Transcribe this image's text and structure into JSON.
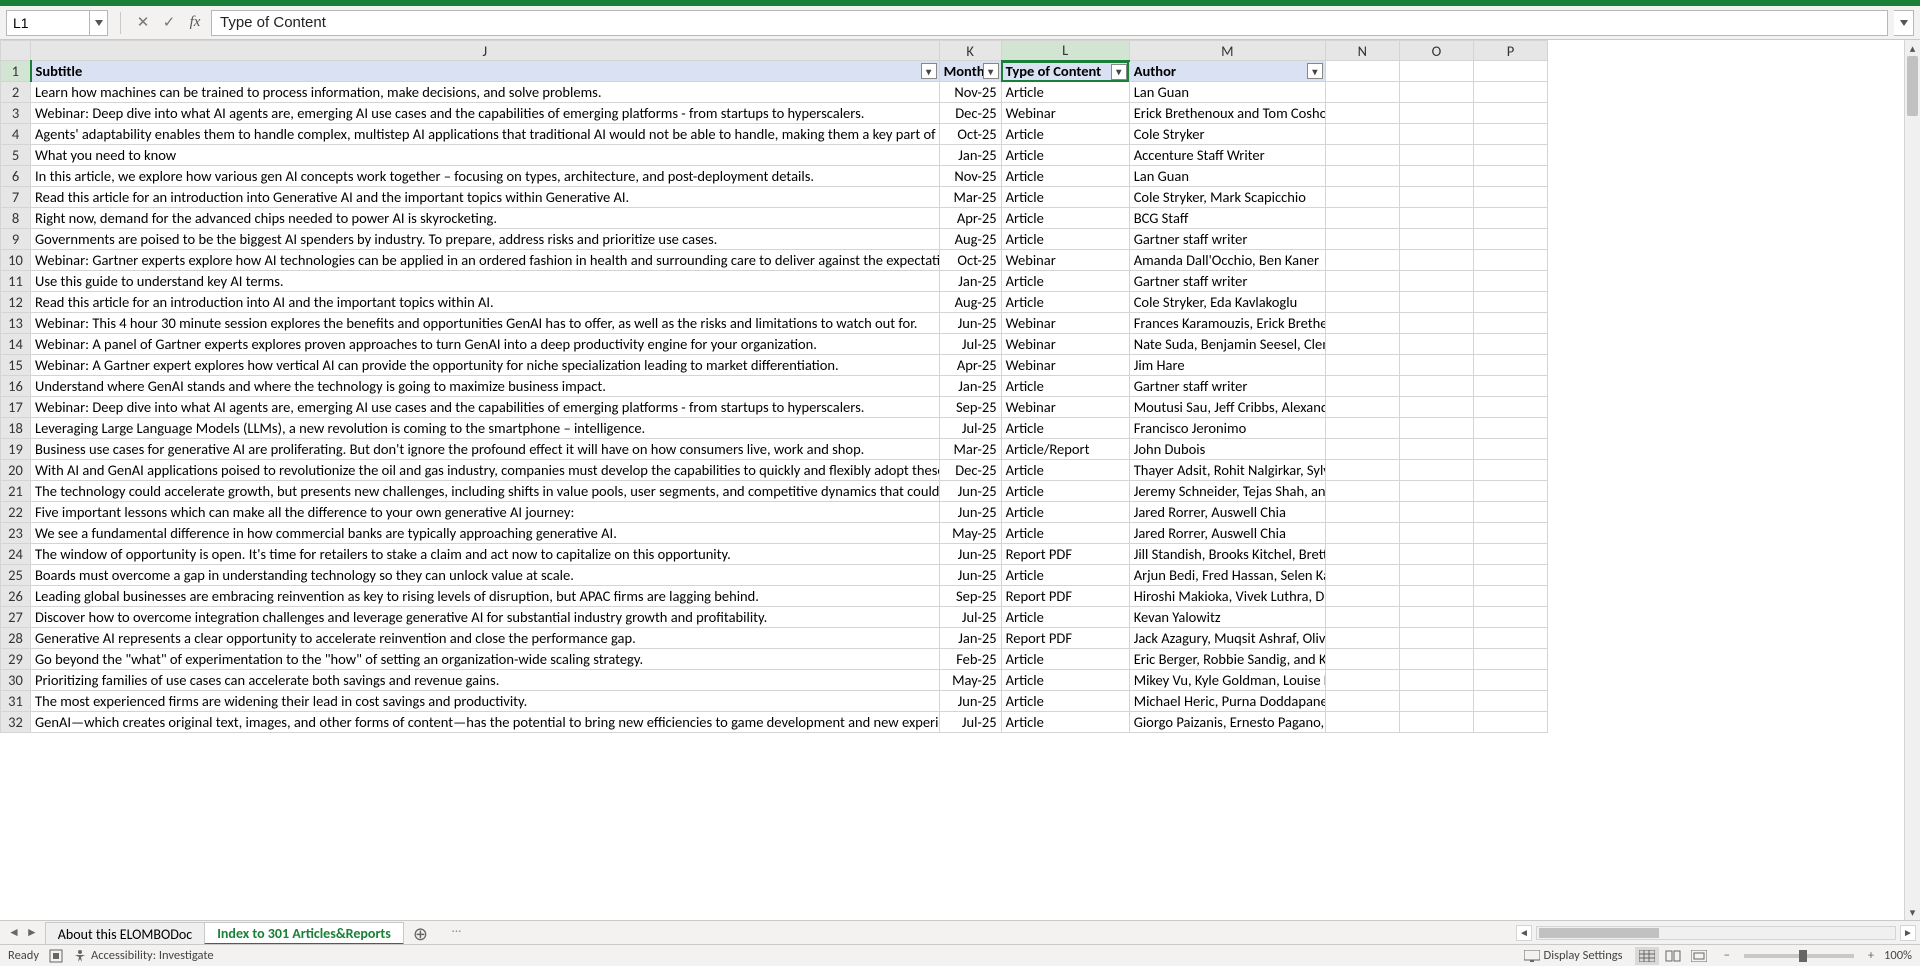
{
  "formula_bar": {
    "cell_ref": "L1",
    "formula_value": "Type of Content"
  },
  "columns": {
    "visible": [
      "J",
      "K",
      "L",
      "M",
      "N",
      "O",
      "P"
    ],
    "selected": "L"
  },
  "header_row": {
    "J": "Subtitle",
    "K": "Month P",
    "L": "Type of Content",
    "M": "Author",
    "N": "",
    "O": "",
    "P": ""
  },
  "rows": [
    {
      "n": 2,
      "J": "Learn how machines can be trained to process information, make decisions, and solve problems.",
      "K": "Nov-25",
      "L": "Article",
      "M": "Lan Guan"
    },
    {
      "n": 3,
      "J": "Webinar: Deep dive into what AI agents are, emerging AI use cases and the capabilities of emerging platforms - from startups to hyperscalers.",
      "K": "Dec-25",
      "L": "Webinar",
      "M": "Erick Brethenoux and Tom Coshow"
    },
    {
      "n": 4,
      "J": "Agents' adaptability enables them to handle complex, multistep AI applications that traditional AI would not be able to handle, making them a key part of the mo",
      "K": "Oct-25",
      "L": "Article",
      "M": "Cole Stryker"
    },
    {
      "n": 5,
      "J": "What you need to know",
      "K": "Jan-25",
      "L": "Article",
      "M": "Accenture Staff Writer"
    },
    {
      "n": 6,
      "J": "In this article, we explore how various gen AI concepts work together – focusing on types, architecture, and post-deployment details.",
      "K": "Nov-25",
      "L": "Article",
      "M": "Lan Guan"
    },
    {
      "n": 7,
      "J": "Read this article for an introduction into Generative AI and the important topics within Generative AI.",
      "K": "Mar-25",
      "L": "Article",
      "M": "Cole Stryker, Mark Scapicchio"
    },
    {
      "n": 8,
      "J": "Right now, demand for the advanced chips needed to power AI is skyrocketing.",
      "K": "Apr-25",
      "L": "Article",
      "M": "BCG Staff"
    },
    {
      "n": 9,
      "J": "Governments are poised to be the biggest AI spenders by industry. To prepare, address risks and prioritize use cases.",
      "K": "Aug-25",
      "L": "Article",
      "M": "Gartner staff writer"
    },
    {
      "n": 10,
      "J": "Webinar: Gartner experts explore how AI technologies can be applied in an ordered fashion in health and surrounding care to deliver against the expectations o",
      "K": "Oct-25",
      "L": "Webinar",
      "M": "Amanda Dall'Occhio, Ben Kaner"
    },
    {
      "n": 11,
      "J": "Use this guide to understand key AI terms.",
      "K": "Jan-25",
      "L": "Article",
      "M": "Gartner staff writer"
    },
    {
      "n": 12,
      "J": "Read this article for an introduction into AI and the important topics within AI.",
      "K": "Aug-25",
      "L": "Article",
      "M": "Cole Stryker, Eda Kavlakoglu"
    },
    {
      "n": 13,
      "J": "Webinar: This 4 hour 30 minute session explores the benefits and opportunities GenAI has to offer, as well as the risks and limitations to watch out for.",
      "K": "Jun-25",
      "L": "Webinar",
      "M": "Frances Karamouzis, Erick Brethenoux, Helen Poitevin, Uma Challa, Ar"
    },
    {
      "n": 14,
      "J": "Webinar: A panel of Gartner experts explores proven approaches to turn GenAI into a deep productivity engine for your organization.",
      "K": "Jul-25",
      "L": "Webinar",
      "M": "Nate Suda, Benjamin Seesel, Clement Christensen"
    },
    {
      "n": 15,
      "J": "Webinar: A Gartner expert explores how vertical AI can provide the opportunity for niche specialization leading to market differentiation.",
      "K": "Apr-25",
      "L": "Webinar",
      "M": "Jim Hare"
    },
    {
      "n": 16,
      "J": "Understand where GenAI stands and where the technology is going to maximize business impact.",
      "K": "Jan-25",
      "L": "Article",
      "M": "Gartner staff writer"
    },
    {
      "n": 17,
      "J": "Webinar: Deep dive into what AI agents are, emerging AI use cases and the capabilities of emerging platforms - from startups to hyperscalers.",
      "K": "Sep-25",
      "L": "Webinar",
      "M": "Moutusi Sau, Jeff Cribbs, Alexander Hoeppe"
    },
    {
      "n": 18,
      "J": "Leveraging Large Language Models (LLMs), a new revolution is coming to the smartphone – intelligence.",
      "K": "Jul-25",
      "L": "Article",
      "M": "Francisco Jeronimo"
    },
    {
      "n": 19,
      "J": "Business use cases for generative AI are proliferating. But don't ignore the profound effect it will have on how consumers live, work and shop.",
      "K": "Mar-25",
      "L": "Article/Report",
      "M": "John Dubois"
    },
    {
      "n": 20,
      "J": "With AI and GenAI applications poised to revolutionize the oil and gas industry, companies must develop the capabilities to quickly and flexibly adopt these new",
      "K": "Dec-25",
      "L": "Article",
      "M": "Thayer Adsit,  Rohit Nalgirkar,  Sylvain Santamarta, Ramya Sethurathina"
    },
    {
      "n": 21,
      "J": "The technology could accelerate growth, but presents new challenges, including shifts in value pools, user segments, and competitive dynamics that could spu",
      "K": "Jun-25",
      "L": "Article",
      "M": "Jeremy Schneider, Tejas Shah, and Joshan Cherian Abraham"
    },
    {
      "n": 22,
      "J": "Five important lessons which can make all the difference to your own generative AI journey:",
      "K": "Jun-25",
      "L": "Article",
      "M": "Jared Rorrer, Auswell Chia"
    },
    {
      "n": 23,
      "J": "We see a fundamental difference in how commercial banks are typically approaching generative AI.",
      "K": "May-25",
      "L": "Article",
      "M": "Jared Rorrer, Auswell Chia"
    },
    {
      "n": 24,
      "J": "The window of opportunity is open. It's time for retailers to stake a claim and act now to capitalize on this opportunity.",
      "K": "Jun-25",
      "L": "Report PDF",
      "M": "Jill Standish, Brooks Kitchel, Brett Leary, Sarah Berger"
    },
    {
      "n": 25,
      "J": "Boards must overcome a gap in understanding technology so they can unlock value at scale.",
      "K": "Jun-25",
      "L": "Article",
      "M": "Arjun Bedi, Fred Hassan, Selen Karaca-Griffin"
    },
    {
      "n": 26,
      "J": "Leading global businesses are embracing reinvention as key to rising levels of disruption, but APAC firms are lagging behind.",
      "K": "Sep-25",
      "L": "Report PDF",
      "M": "Hiroshi Makioka, Vivek Luthra, Dr. Serena Jiong Qiu"
    },
    {
      "n": 27,
      "J": "Discover how to overcome integration challenges and leverage generative AI for substantial industry growth and profitability.",
      "K": "Jul-25",
      "L": "Article",
      "M": "Kevan Yalowitz"
    },
    {
      "n": 28,
      "J": "Generative AI represents a clear opportunity to accelerate reinvention and close the performance gap.",
      "K": "Jan-25",
      "L": "Report PDF",
      "M": "Jack Azagury, Muqsit Ashraf, Oliver Wright, Karen Fang Grant, Mike Moo"
    },
    {
      "n": 29,
      "J": "Go beyond the \"what\" of experimentation to the \"how\" of setting an organization-wide scaling strategy.",
      "K": "Feb-25",
      "L": "Article",
      "M": "Eric Berger, Robbie Sandig, and KC George"
    },
    {
      "n": 30,
      "J": "Prioritizing families of use cases can accelerate both savings and revenue gains.",
      "K": "May-25",
      "L": "Article",
      "M": "Mikey Vu, Kyle Goldman, Louise Keely, Carla Nasr, and François Vayleu"
    },
    {
      "n": 31,
      "J": "The most experienced firms are widening their lead in cost savings and productivity.",
      "K": "Jun-25",
      "L": "Article",
      "M": "Michael Heric, Purna Doddapaneni, and Don Sweeney"
    },
    {
      "n": 32,
      "J": "GenAI—which creates original text, images, and other forms of content—has the potential to bring new efficiencies to game development and new experiences",
      "K": "Jul-25",
      "L": "Article",
      "M": "Giorgo Paizanis,  Ernesto Pagano, David Sammons,  and Nicolas Schmi"
    }
  ],
  "tabs": {
    "items": [
      "About this ELOMBODoc",
      "Index to 301 Articles&Reports"
    ],
    "active_index": 1,
    "ellipsis": "…"
  },
  "status": {
    "ready": "Ready",
    "accessibility": "Accessibility: Investigate",
    "display_settings": "Display Settings",
    "zoom": "100%"
  }
}
